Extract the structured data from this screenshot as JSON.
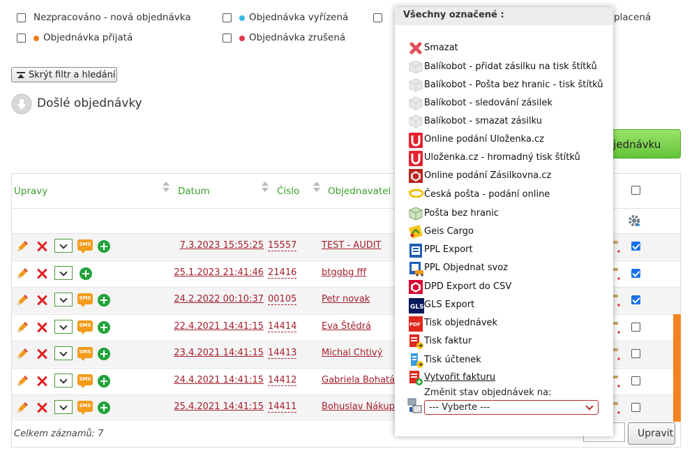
{
  "filters": [
    {
      "label": "Nezpracováno - nová objednávka",
      "dot": null
    },
    {
      "label": "Objednávka vyřízená",
      "dot": "#39b8e8"
    },
    {
      "label": "placená",
      "dot": "#2db34a"
    },
    {
      "label": "Objednávka přijatá",
      "dot": "#ef7d14"
    },
    {
      "label": "Objednávka zrušená",
      "dot": "#e0374a"
    }
  ],
  "toolbar": {
    "hide_filter_label": "Skrýt filtr a hledání",
    "section_title": "Došlé objednávky",
    "new_order_label": "ojednávku"
  },
  "table": {
    "headers": {
      "edits": "Úpravy",
      "date": "Datum",
      "number": "Číslo",
      "customer": "Objednavatel"
    },
    "rows": [
      {
        "date": "7.3.2023 15:55:25",
        "number": "15557",
        "customer": "TEST - AUDIT",
        "sms": true,
        "checked": true,
        "orange": false
      },
      {
        "date": "25.1.2023 21:41:46",
        "number": "21416",
        "customer": "btggbg fff",
        "sms": false,
        "checked": true,
        "orange": false
      },
      {
        "date": "24.2.2022 00:10:37",
        "number": "00105",
        "customer": "Petr novak",
        "sms": true,
        "checked": true,
        "orange": false
      },
      {
        "date": "22.4.2021 14:41:15",
        "number": "14414",
        "customer": "Eva Štědrá",
        "sms": true,
        "checked": false,
        "orange": true
      },
      {
        "date": "23.4.2021 14:41:15",
        "number": "14413",
        "customer": "Michal Chtivý",
        "sms": true,
        "checked": false,
        "orange": true
      },
      {
        "date": "24.4.2021 14:41:15",
        "number": "14412",
        "customer": "Gabriela Bohatá",
        "sms": true,
        "checked": false,
        "orange": true
      },
      {
        "date": "25.4.2021 14:41:15",
        "number": "14411",
        "customer": "Bohuslav Nákupč",
        "sms": true,
        "checked": false,
        "orange": true
      }
    ],
    "footer_total": "Celkem záznamů: 7",
    "update_button": "Upravit"
  },
  "popup": {
    "title": "Všechny označené :",
    "items": [
      {
        "label": "Smazat",
        "icon": "delete-icon"
      },
      {
        "label": "Balíkobot - přidat zásilku na tisk štítků",
        "icon": "package-icon"
      },
      {
        "label": "Balíkobot - Pošta bez hranic - tisk štítků",
        "icon": "package-icon"
      },
      {
        "label": "Balíkobot - sledování zásilek",
        "icon": "package-icon"
      },
      {
        "label": "Balíkobot - smazat zásilku",
        "icon": "package-icon"
      },
      {
        "label": "Online podání Uloženka.cz",
        "icon": "ulozenka-icon"
      },
      {
        "label": "Uloženka.cz - hromadný tisk štítků",
        "icon": "ulozenka-icon"
      },
      {
        "label": "Online podání Zásilkovna.cz",
        "icon": "zasilkovna-icon"
      },
      {
        "label": "Česká pošta - podání online",
        "icon": "posthorn-icon"
      },
      {
        "label": "Pošta bez hranic",
        "icon": "package-green-icon"
      },
      {
        "label": "Geis Cargo",
        "icon": "geis-icon"
      },
      {
        "label": "PPL Export",
        "icon": "ppl-icon"
      },
      {
        "label": "PPL Objednat svoz",
        "icon": "ppl-truck-icon"
      },
      {
        "label": "DPD Export do CSV",
        "icon": "dpd-icon"
      },
      {
        "label": "GLS Export",
        "icon": "gls-icon"
      },
      {
        "label": "Tisk objednávek",
        "icon": "pdf-icon"
      },
      {
        "label": "Tisk faktur",
        "icon": "invoice-icon"
      },
      {
        "label": "Tisk účtenek",
        "icon": "receipt-icon"
      },
      {
        "label": "Vytvořit fakturu",
        "icon": "invoice-add-icon"
      }
    ],
    "change_state_label": "Změnit stav objednávek na:",
    "select_value": "--- Vyberte ---"
  },
  "colors": {
    "accent_green": "#3a9e2b",
    "link_red": "#a41e2b",
    "orange": "#f58220"
  }
}
